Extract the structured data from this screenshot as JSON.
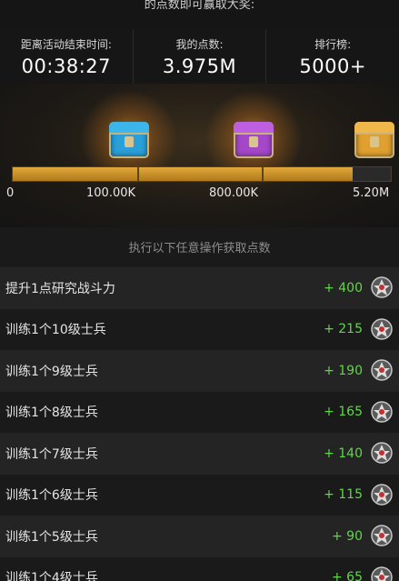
{
  "header_partial": "的点数即可赢取大奖:",
  "stats": [
    {
      "label": "距离活动结束时间:",
      "value": "00:38:27"
    },
    {
      "label": "我的点数:",
      "value": "3.975M"
    },
    {
      "label": "排行榜:",
      "value": "5000+"
    }
  ],
  "milestones": [
    "0",
    "100.00K",
    "800.00K",
    "5.20M"
  ],
  "chests": [
    {
      "icon": "blue-chest-icon",
      "color": "#2a9fd8"
    },
    {
      "icon": "purple-chest-icon",
      "color": "#a447c9"
    },
    {
      "icon": "gold-chest-icon",
      "color": "#e0a030"
    }
  ],
  "progress_fill_fraction": 0.9,
  "section_title": "执行以下任意操作获取点数",
  "tasks": [
    {
      "name": "提升1点研究战斗力",
      "points": "+ 400"
    },
    {
      "name": "训练1个10级士兵",
      "points": "+ 215"
    },
    {
      "name": "训练1个9级士兵",
      "points": "+ 190"
    },
    {
      "name": "训练1个8级士兵",
      "points": "+ 165"
    },
    {
      "name": "训练1个7级士兵",
      "points": "+ 140"
    },
    {
      "name": "训练1个6级士兵",
      "points": "+ 115"
    },
    {
      "name": "训练1个5级士兵",
      "points": "+ 90"
    },
    {
      "name": "训练1个4级士兵",
      "points": "+ 65"
    }
  ],
  "colors": {
    "points_green": "#62d64a",
    "progress_gold": "#e2a83a"
  }
}
